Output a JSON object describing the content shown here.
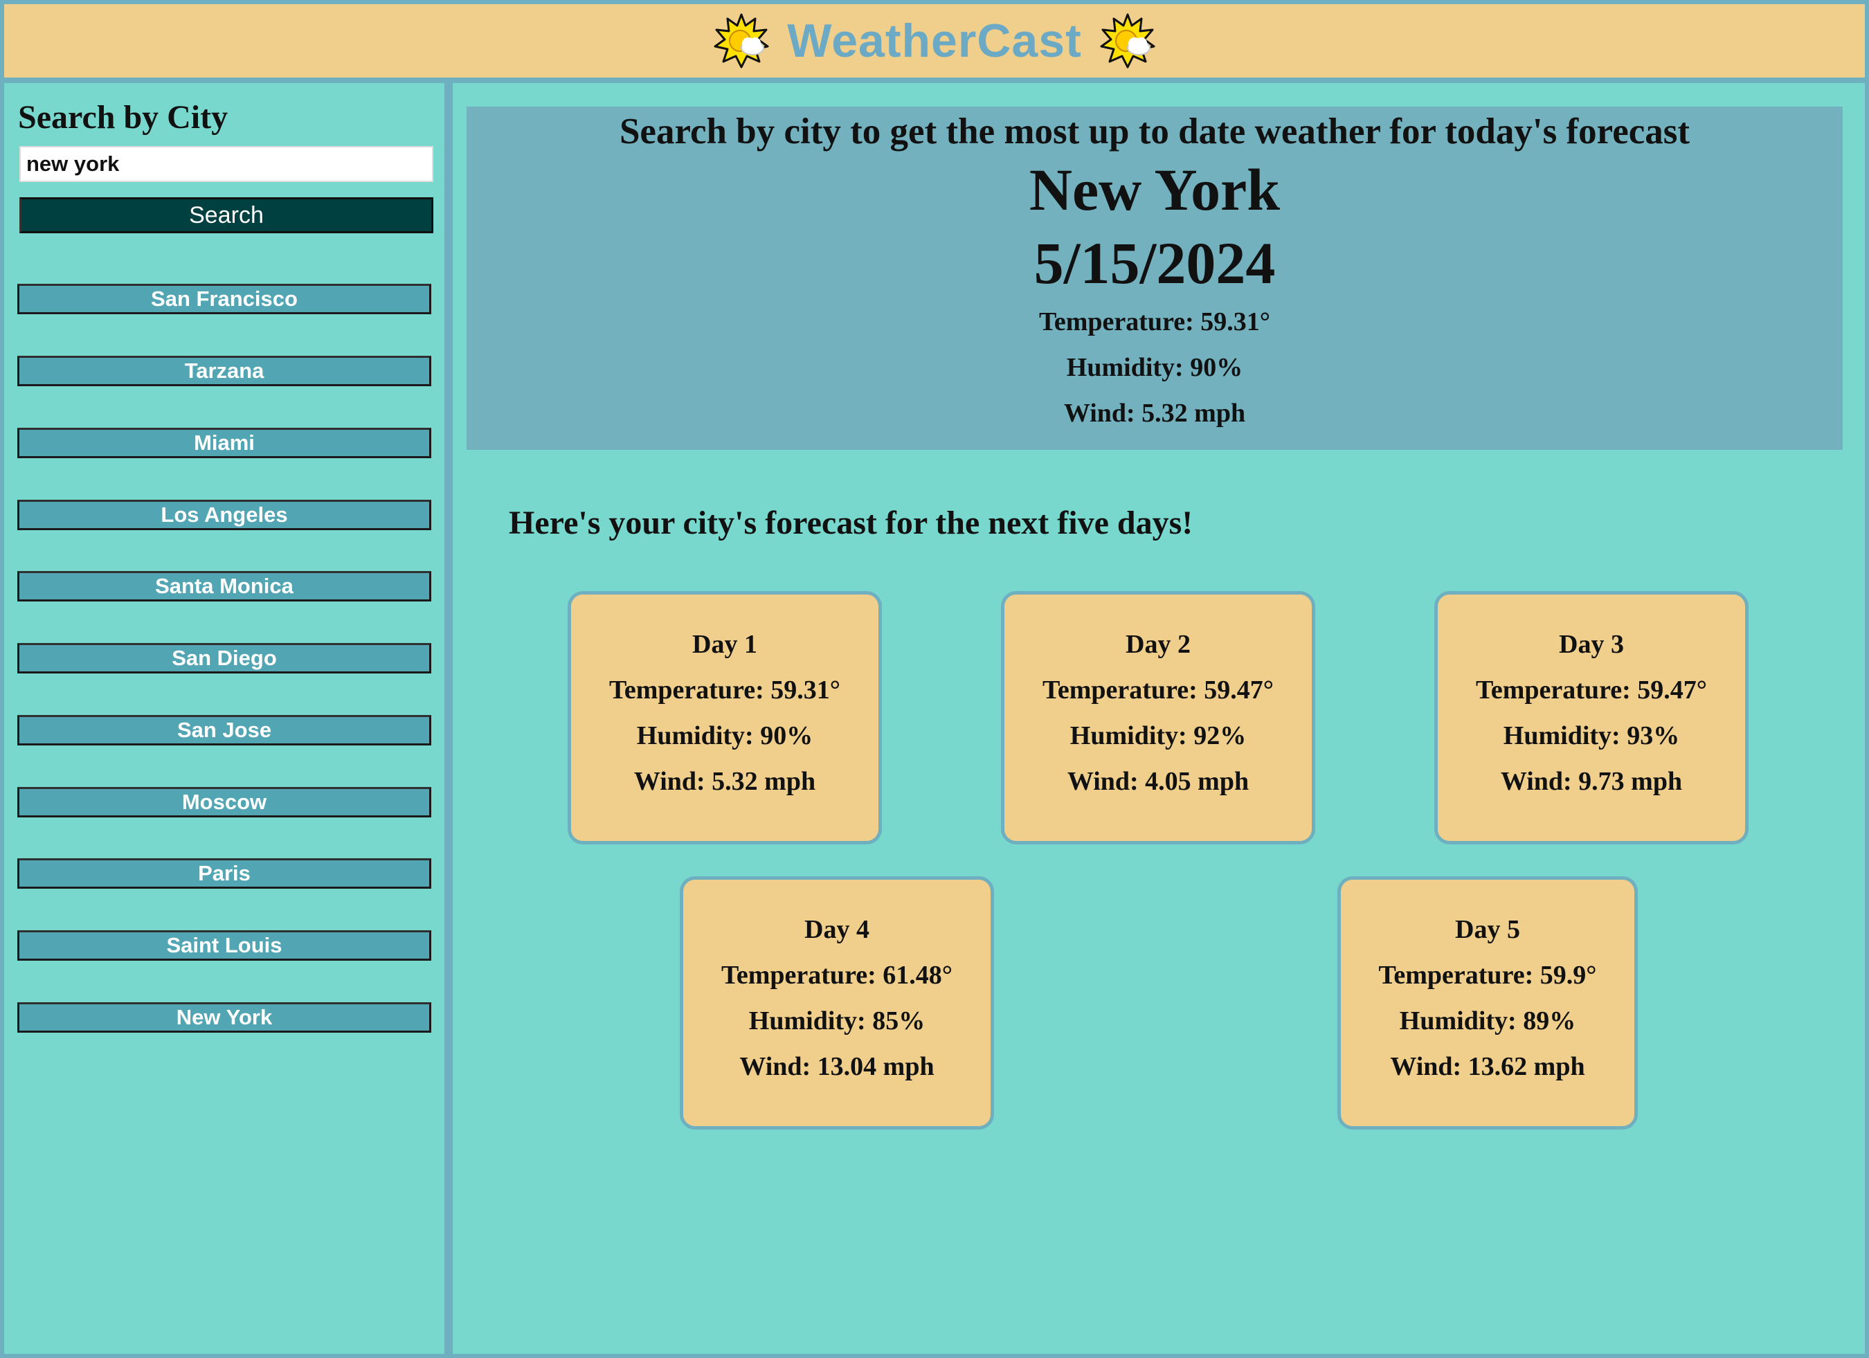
{
  "app": {
    "title": "WeatherCast",
    "left_icon": "sun-cloud-icon",
    "right_icon": "sun-cloud-icon",
    "brand_color": "#6ba9c4"
  },
  "colors": {
    "header_bg": "#f0cf8d",
    "page_bg": "#79d8cd",
    "border": "#6eb0bf",
    "panel_bg": "#73b1bf",
    "search_button_bg": "#004040",
    "city_button_bg": "#52a5b3",
    "card_bg": "#f0cf8d"
  },
  "sidebar": {
    "heading": "Search by City",
    "search_value": "new york",
    "search_button_label": "Search",
    "cities": [
      "San Francisco",
      "Tarzana",
      "Miami",
      "Los Angeles",
      "Santa Monica",
      "San Diego",
      "San Jose",
      "Moscow",
      "Paris",
      "Saint Louis",
      "New York"
    ]
  },
  "current": {
    "intro": "Search by city to get the most up to date weather for today's forecast",
    "city": "New York",
    "date": "5/15/2024",
    "temperature": "Temperature: 59.31°",
    "humidity": "Humidity: 90%",
    "wind": "Wind: 5.32 mph"
  },
  "forecast": {
    "heading": "Here's your city's forecast for the next five days!",
    "days": [
      {
        "label": "Day 1",
        "temperature": "Temperature: 59.31°",
        "humidity": "Humidity: 90%",
        "wind": "Wind: 5.32 mph"
      },
      {
        "label": "Day 2",
        "temperature": "Temperature: 59.47°",
        "humidity": "Humidity: 92%",
        "wind": "Wind: 4.05 mph"
      },
      {
        "label": "Day 3",
        "temperature": "Temperature: 59.47°",
        "humidity": "Humidity: 93%",
        "wind": "Wind: 9.73 mph"
      },
      {
        "label": "Day 4",
        "temperature": "Temperature: 61.48°",
        "humidity": "Humidity: 85%",
        "wind": "Wind: 13.04 mph"
      },
      {
        "label": "Day 5",
        "temperature": "Temperature: 59.9°",
        "humidity": "Humidity: 89%",
        "wind": "Wind: 13.62 mph"
      }
    ]
  }
}
